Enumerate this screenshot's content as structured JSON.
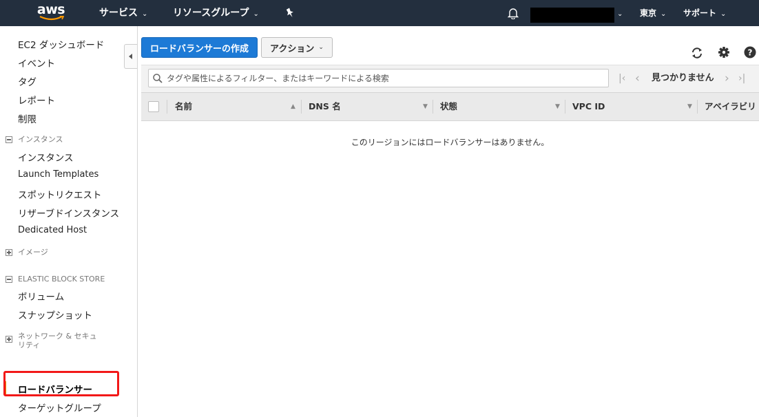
{
  "topnav": {
    "logo": "aws",
    "services": "サービス",
    "resource_groups": "リソースグループ",
    "region": "東京",
    "support": "サポート",
    "chevron": "⌄",
    "icons": [
      "bell-icon",
      "pin-icon"
    ]
  },
  "sidebar": {
    "top_links": [
      "EC2 ダッシュボード",
      "イベント",
      "タグ",
      "レポート",
      "制限"
    ],
    "instances_section": "インスタンス",
    "instances_links": [
      "インスタンス",
      "Launch Templates",
      "スポットリクエスト",
      "リザーブドインスタンス",
      "Dedicated Host"
    ],
    "images_section": "イメージ",
    "ebs_section": "ELASTIC BLOCK STORE",
    "ebs_links": [
      "ボリューム",
      "スナップショット"
    ],
    "network_section": "ネットワーク & セキュリティ",
    "lb_links": [
      "ロードバランサー",
      "ターゲットグループ"
    ]
  },
  "toolbar": {
    "create_label": "ロードバランサーの作成",
    "actions_label": "アクション",
    "icons": [
      "refresh-icon",
      "gear-icon",
      "help-icon"
    ]
  },
  "filter": {
    "placeholder": "タグや属性によるフィルター、またはキーワードによる検索",
    "pager_text": "見つかりません"
  },
  "table": {
    "columns": [
      "名前",
      "DNS 名",
      "状態",
      "VPC ID",
      "アベイラビリ"
    ]
  },
  "empty_message": "このリージョンにはロードバランサーはありません。",
  "colors": {
    "nav_bg": "#232f3e",
    "primary": "#1d7ad6",
    "highlight": "#f21818",
    "active_bar": "#e98a00"
  }
}
